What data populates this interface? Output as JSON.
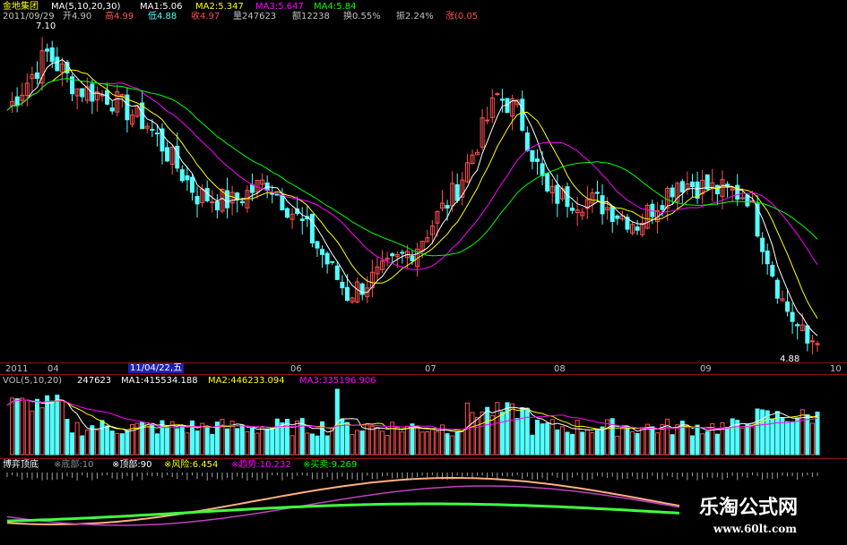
{
  "header": {
    "stock_name": "金地集团",
    "ma_params": "MA(5,10,20,30)",
    "ma1": "MA1:5.06",
    "ma2": "MA2:5.347",
    "ma3": "MA3:5.647",
    "ma4": "MA4:5.84",
    "date": "2011/09/29",
    "open": "开4.90",
    "high": "高4.99",
    "low": "低4.88",
    "close": "收4.97",
    "volume": "量247623",
    "amount": "额12238",
    "turnover": "换0.55%",
    "amplitude": "振2.24%",
    "change": "涨(0.05"
  },
  "price_labels": {
    "max": "7.10",
    "min": "4.88"
  },
  "time_axis": {
    "start": "2011",
    "m04": "04",
    "cursor": "11/04/22,五",
    "m06": "06",
    "m07": "07",
    "m08": "08",
    "m09": "09",
    "m10": "10"
  },
  "vol_header": {
    "params": "VOL(5,10,20)",
    "vol": "247623",
    "ma1": "MA1:415534.188",
    "ma2": "MA2:446233.094",
    "ma3": "MA3:335196.906"
  },
  "indicator_header": {
    "name": "博弈顶底",
    "p1": "※底部:10",
    "p2": "※顶部:90",
    "p3": "※风险:6.454",
    "p4": "※趋势:10.232",
    "p5": "※买卖:9.269"
  },
  "watermark": {
    "title": "乐淘公式网",
    "url": "www.60lt.com"
  },
  "colors": {
    "up": "#ff5050",
    "down": "#54ffff",
    "ma1": "#ffffff",
    "ma2": "#ffff00",
    "ma3": "#ff00ff",
    "ma4": "#00ff00",
    "axis_red": "#b01010",
    "volume_ma1": "#ffffff",
    "volume_ma2": "#ffff00",
    "volume_ma3": "#ff00ff"
  }
}
